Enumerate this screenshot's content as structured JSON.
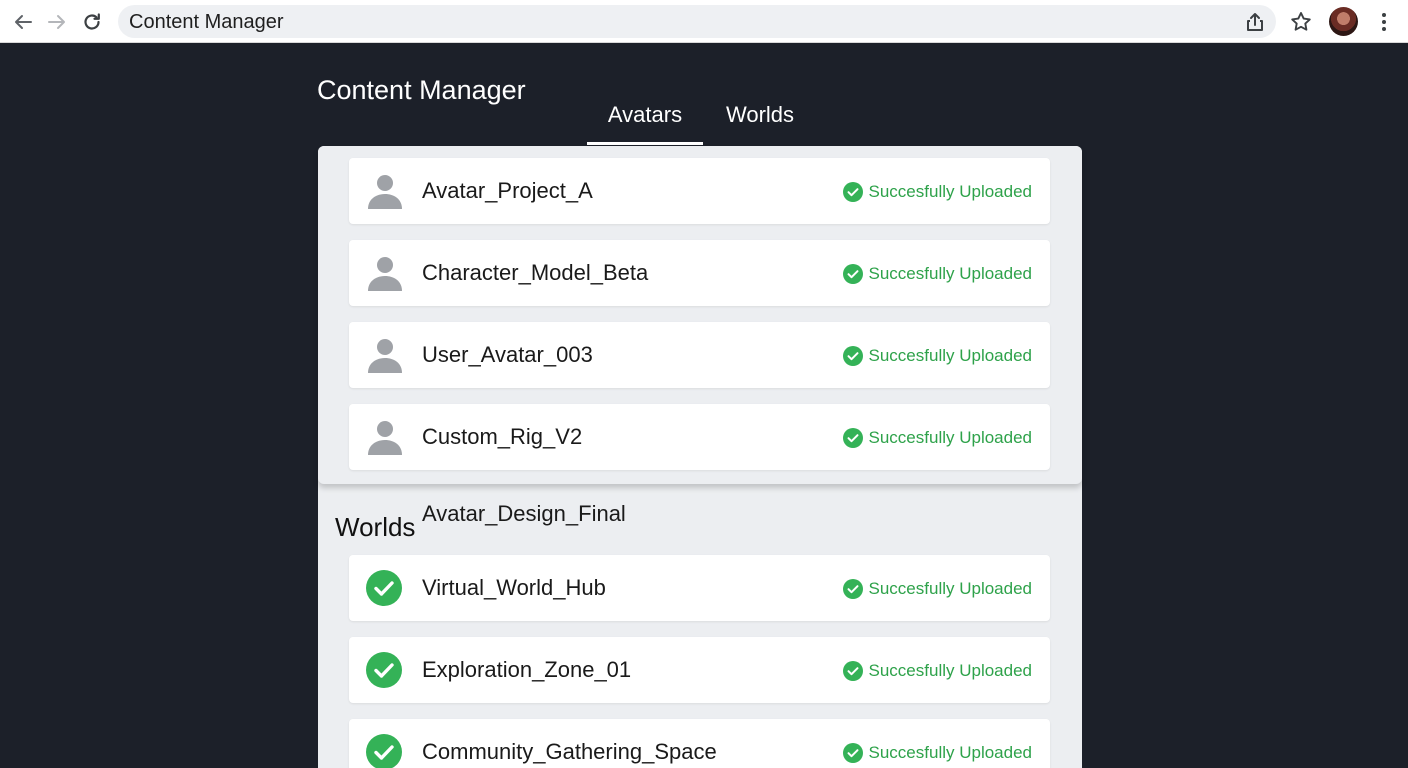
{
  "browser": {
    "tab_title": "Content Manager",
    "icons": {
      "back": "arrow-left-icon",
      "forward": "arrow-right-icon",
      "reload": "reload-icon",
      "share": "share-icon",
      "bookmark": "star-icon",
      "profile": "avatar",
      "menu": "more-vert-icon"
    }
  },
  "page": {
    "title": "Content Manager",
    "tabs": [
      {
        "label": "Avatars",
        "active": true
      },
      {
        "label": "Worlds",
        "active": false
      }
    ]
  },
  "avatars": {
    "items": [
      {
        "name": "Avatar_Project_A",
        "status": "Succesfully Uploaded"
      },
      {
        "name": "Character_Model_Beta",
        "status": "Succesfully Uploaded"
      },
      {
        "name": "User_Avatar_003",
        "status": "Succesfully Uploaded"
      },
      {
        "name": "Custom_Rig_V2",
        "status": "Succesfully Uploaded"
      }
    ],
    "extra_label": "Avatar_Design_Final"
  },
  "worlds": {
    "heading": "Worlds",
    "items": [
      {
        "name": "Virtual_World_Hub",
        "status": "Succesfully Uploaded"
      },
      {
        "name": "Exploration_Zone_01",
        "status": "Succesfully Uploaded"
      },
      {
        "name": "Community_Gathering_Space",
        "status": "Succesfully Uploaded"
      }
    ]
  },
  "colors": {
    "background": "#1c2029",
    "panel": "#eceef1",
    "success": "#2ea24a",
    "success_icon": "#34b257"
  }
}
